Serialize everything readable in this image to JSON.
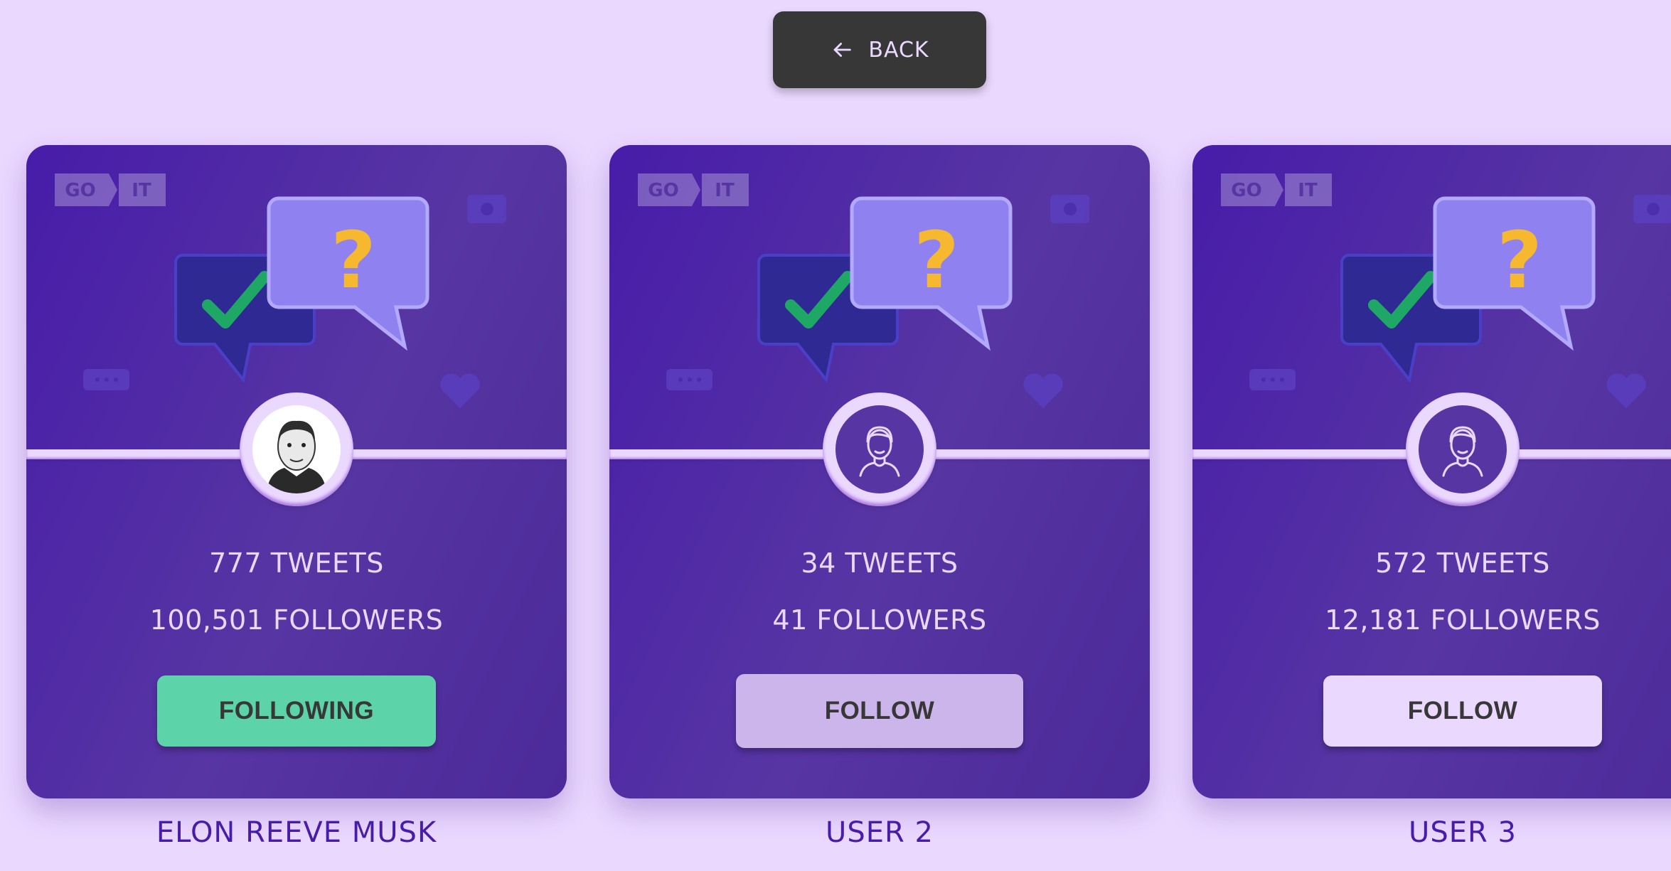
{
  "back_button": {
    "label": "BACK",
    "icon": "arrow-left-icon"
  },
  "logo": {
    "left": "GO",
    "right": "IT"
  },
  "colors": {
    "page_bg": "#EBD8FF",
    "card_bg": "#5736A3",
    "following": "#5CD3A8",
    "follow": "#EBD8FF",
    "username": "#471CA9"
  },
  "cards": [
    {
      "tweets": "777 TWEETS",
      "followers": "100,501 FOLLOWERS",
      "button": "FOLLOWING",
      "state": "following",
      "avatar": "portrait-photo",
      "name": "ELON REEVE MUSK"
    },
    {
      "tweets": "34 TWEETS",
      "followers": "41 FOLLOWERS",
      "button": "FOLLOW",
      "state": "hover",
      "avatar": "default-user-icon",
      "name": "USER 2"
    },
    {
      "tweets": "572 TWEETS",
      "followers": "12,181 FOLLOWERS",
      "button": "FOLLOW",
      "state": "follow",
      "avatar": "default-user-icon",
      "name": "USER 3"
    }
  ]
}
